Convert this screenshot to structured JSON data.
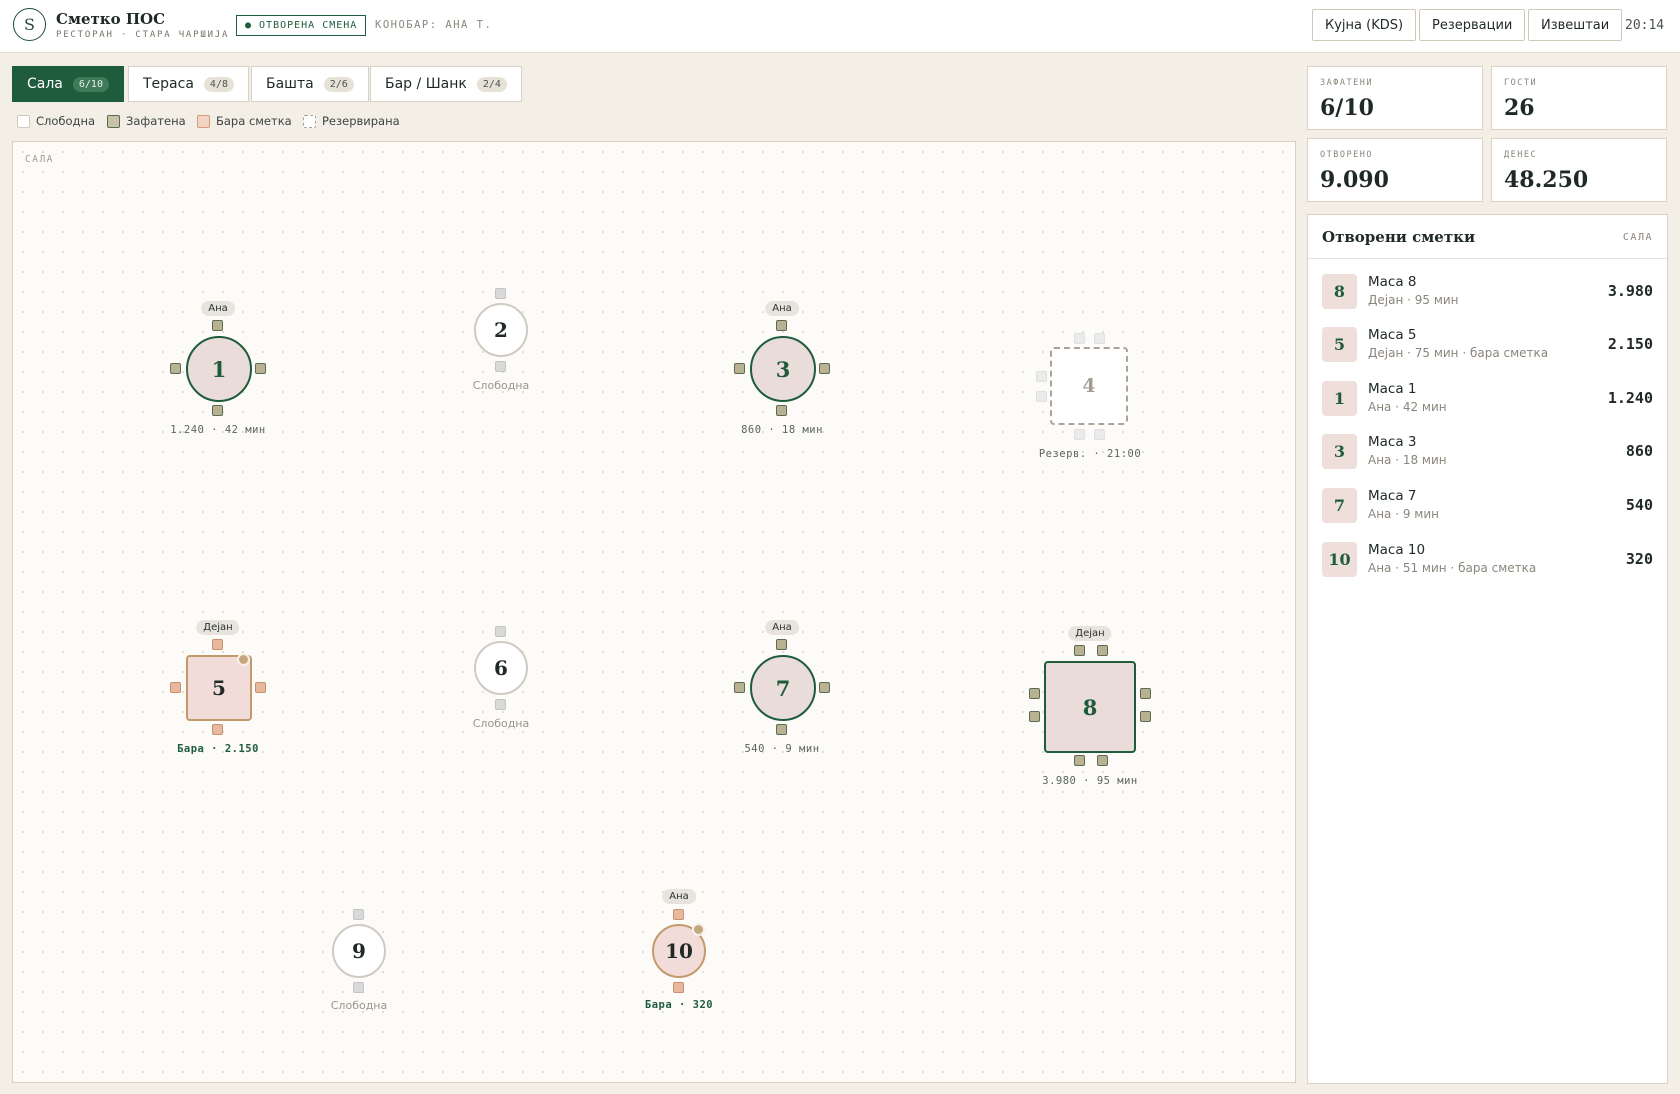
{
  "app": {
    "logo_letter": "S",
    "name": "Сметко ПОС",
    "subtitle": "РЕСТОРАН · СТАРА ЧАРШИЈА",
    "shift_badge": "● ОТВОРЕНА СМЕНА",
    "waiter": "КОНОБАР: АНА Т.",
    "buttons": {
      "kitchen": "Кујна (KDS)",
      "reservations": "Резервации",
      "reports": "Извештаи"
    },
    "clock": "20:14"
  },
  "tabs": [
    {
      "label": "Сала",
      "count": "6/10",
      "active": true
    },
    {
      "label": "Тераса",
      "count": "4/8",
      "active": false
    },
    {
      "label": "Башта",
      "count": "2/6",
      "active": false
    },
    {
      "label": "Бар / Шанк",
      "count": "2/4",
      "active": false
    }
  ],
  "legend": {
    "free": "Слободна",
    "occupied": "Зафатена",
    "bill": "Бара сметка",
    "reserved": "Резервирана"
  },
  "floor": {
    "label": "САЛА",
    "tables": [
      {
        "number": "1",
        "server": "Ана",
        "label": "1.240 · 42 мин",
        "status": "occupied"
      },
      {
        "number": "2",
        "server": "",
        "label": "Слободна",
        "status": "free"
      },
      {
        "number": "3",
        "server": "Ана",
        "label": "860 · 18 мин",
        "status": "occupied"
      },
      {
        "number": "4",
        "server": "",
        "label": "Резерв. · 21:00",
        "status": "reserved"
      },
      {
        "number": "5",
        "server": "Дејан",
        "label": "Бара · 2.150",
        "status": "bill"
      },
      {
        "number": "6",
        "server": "",
        "label": "Слободна",
        "status": "free"
      },
      {
        "number": "7",
        "server": "Ана",
        "label": "540 · 9 мин",
        "status": "occupied"
      },
      {
        "number": "8",
        "server": "Дејан",
        "label": "3.980 · 95 мин",
        "status": "occupied"
      },
      {
        "number": "9",
        "server": "",
        "label": "Слободна",
        "status": "free"
      },
      {
        "number": "10",
        "server": "Ана",
        "label": "Бара · 320",
        "status": "bill"
      }
    ]
  },
  "stats": {
    "occupied": {
      "label": "ЗАФАТЕНИ",
      "value": "6/10"
    },
    "guests": {
      "label": "ГОСТИ",
      "value": "26"
    },
    "open": {
      "label": "ОТВОРЕНО",
      "value": "9.090"
    },
    "today": {
      "label": "ДЕНЕС",
      "value": "48.250"
    }
  },
  "open_bills": {
    "title": "Отворени сметки",
    "area": "САЛА",
    "items": [
      {
        "badge": "8",
        "name": "Маса 8",
        "meta": "Дејан · 95 мин",
        "amount": "3.980"
      },
      {
        "badge": "5",
        "name": "Маса 5",
        "meta": "Дејан · 75 мин · бара сметка",
        "amount": "2.150"
      },
      {
        "badge": "1",
        "name": "Маса 1",
        "meta": "Ана · 42 мин",
        "amount": "1.240"
      },
      {
        "badge": "3",
        "name": "Маса 3",
        "meta": "Ана · 18 мин",
        "amount": "860"
      },
      {
        "badge": "7",
        "name": "Маса 7",
        "meta": "Ана · 9 мин",
        "amount": "540"
      },
      {
        "badge": "10",
        "name": "Маса 10",
        "meta": "Ана · 51 мин · бара сметка",
        "amount": "320"
      }
    ]
  }
}
